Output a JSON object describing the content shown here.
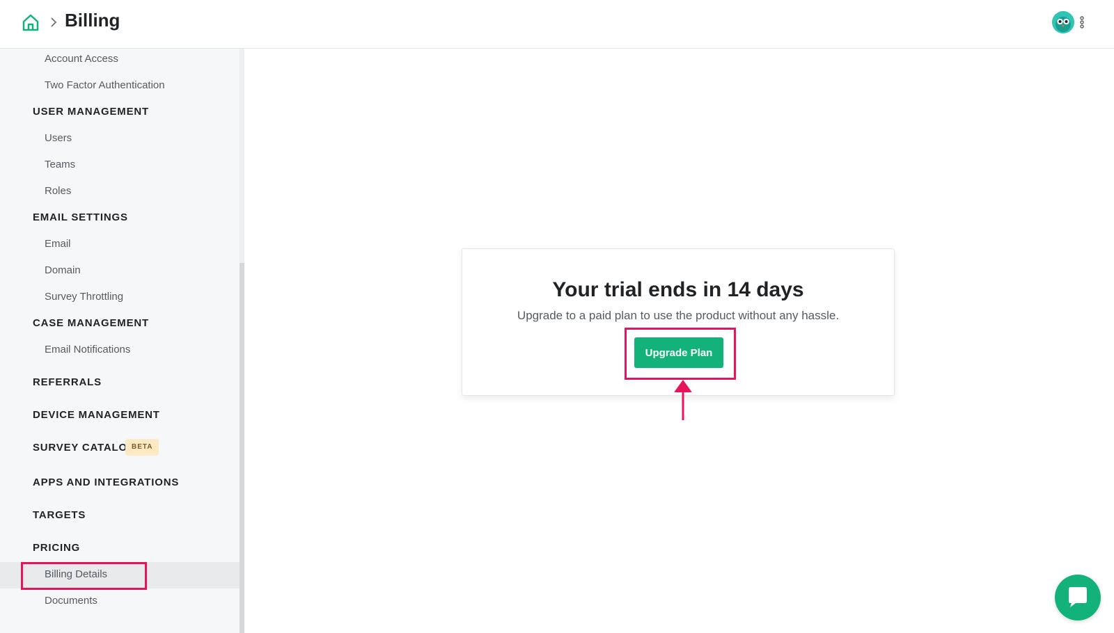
{
  "header": {
    "title": "Billing",
    "home_icon": "home-icon",
    "separator_icon": "chevron-right-icon",
    "avatar_icon": "owl-avatar",
    "menu_icon": "kebab-vertical-icon"
  },
  "sidebar": {
    "security_items": [
      "Account Access",
      "Two Factor Authentication"
    ],
    "user_management": {
      "label": "USER MANAGEMENT",
      "items": [
        "Users",
        "Teams",
        "Roles"
      ]
    },
    "email_settings": {
      "label": "EMAIL SETTINGS",
      "items": [
        "Email",
        "Domain",
        "Survey Throttling"
      ]
    },
    "case_management": {
      "label": "CASE MANAGEMENT",
      "items": [
        "Email Notifications"
      ]
    },
    "referrals": "REFERRALS",
    "device_management": "DEVICE MANAGEMENT",
    "survey_catalog": {
      "label": "SURVEY CATALOG",
      "badge": "BETA"
    },
    "apps_integrations": "APPS AND INTEGRATIONS",
    "targets": "TARGETS",
    "pricing": {
      "label": "PRICING",
      "items": [
        "Billing Details",
        "Documents"
      ],
      "active": "Billing Details"
    }
  },
  "trial_card": {
    "title": "Your trial ends in 14 days",
    "subtitle": "Upgrade to a paid plan to use the product without any hassle.",
    "button_label": "Upgrade Plan"
  },
  "colors": {
    "accent_green": "#12b27a",
    "highlight_pink": "#e8145a",
    "badge_bg": "#fde9c4"
  },
  "chat_widget_icon": "chat-bubble-icon"
}
